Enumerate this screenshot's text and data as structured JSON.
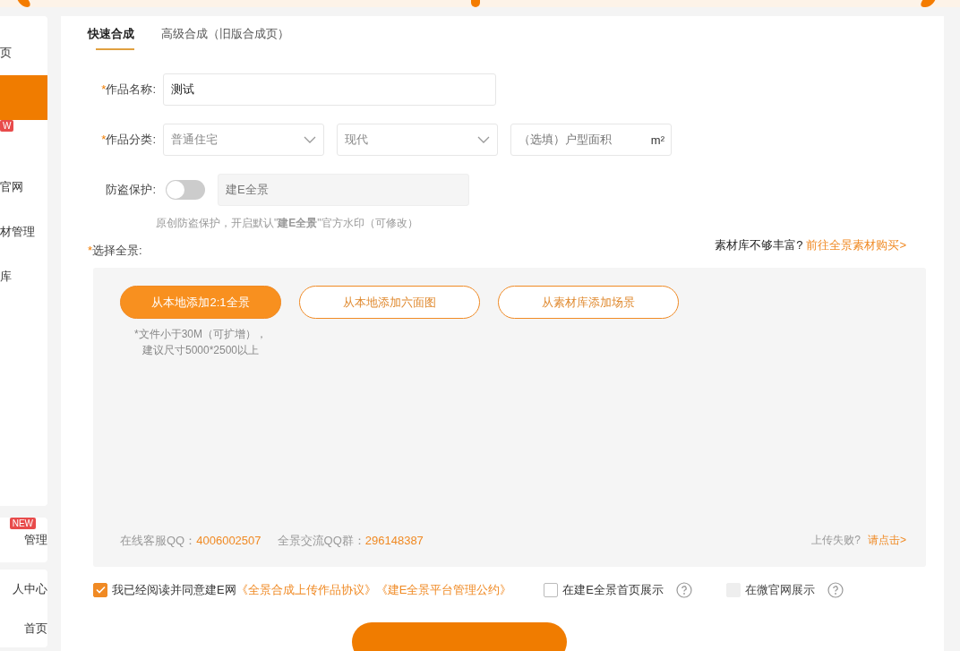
{
  "sidebar": {
    "items": [
      {
        "label": "页",
        "selected": false
      },
      {
        "selected": true
      },
      {
        "badge": "W",
        "selected": false
      },
      {
        "label": "官网",
        "selected": false
      },
      {
        "label": "材管理",
        "selected": false
      },
      {
        "label": "库",
        "selected": false
      }
    ],
    "lower_items": [
      {
        "label": "管理",
        "badge": "NEW"
      },
      {
        "label": "人中心"
      },
      {
        "label": "首页"
      }
    ]
  },
  "tabs": [
    {
      "label": "快速合成",
      "selected": true
    },
    {
      "label": "高级合成（旧版合成页）",
      "selected": false
    }
  ],
  "name_field": {
    "required_mark": "*",
    "label": "作品名称:",
    "value": "测试"
  },
  "category": {
    "required_mark": "*",
    "label": "作品分类:",
    "selects": [
      {
        "value": "普通住宅"
      },
      {
        "value": "现代"
      }
    ],
    "area": {
      "placeholder": "（选填）户型面积",
      "unit": "m²"
    }
  },
  "protection": {
    "label": "防盗保护:",
    "on": false,
    "placeholder": "建E全景",
    "hint": "原创防盗保护，开启默认\"**建E全景**\"官方水印（可修改）"
  },
  "panorama": {
    "required_mark": "*",
    "label": "选择全景:",
    "promo_text": "素材库不够丰富?",
    "promo_link": "前往全景素材购买>",
    "buttons": [
      {
        "label": "从本地添加2:1全景",
        "kind": "primary"
      },
      {
        "label": "从本地添加六面图",
        "kind": "outline"
      },
      {
        "label": "从素材库添加场景",
        "kind": "outline"
      }
    ],
    "note": [
      "*文件小于30M（可扩增），",
      "建议尺寸5000*2500以上"
    ],
    "contacts": [
      {
        "label": "在线客服QQ：",
        "value": "4006002507"
      },
      {
        "label": "全景交流QQ群：",
        "value": "296148387"
      }
    ],
    "fail_text": "上传失败?",
    "fail_link": "请点击>"
  },
  "agreement": {
    "checked": true,
    "text": "我已经阅读并同意建E网",
    "links": [
      "《全景合成上传作品协议》",
      "《建E全景平台管理公约》"
    ]
  },
  "options": [
    {
      "label": "在建E全景首页展示",
      "checked": false,
      "disabled": false
    },
    {
      "label": "在微官网展示",
      "checked": false,
      "disabled": true
    }
  ],
  "actions": [
    {
      "kind": "primary"
    }
  ]
}
